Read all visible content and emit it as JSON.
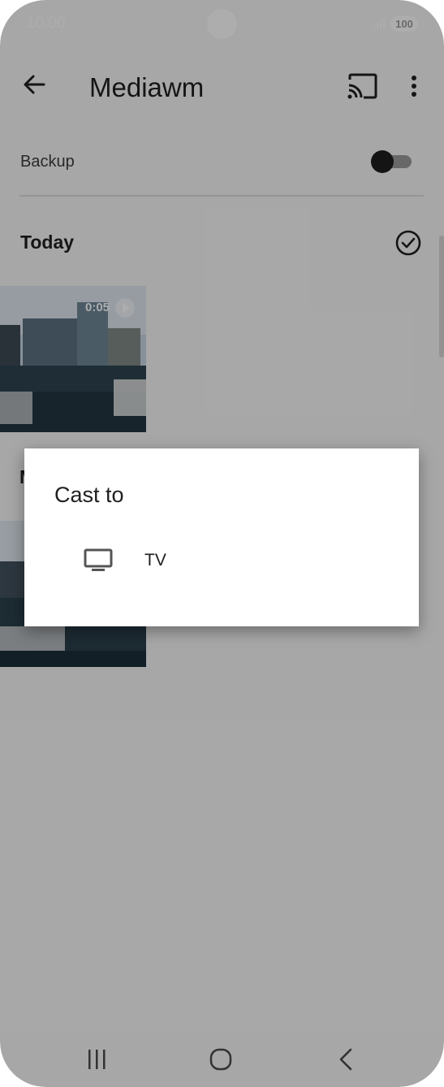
{
  "status_bar": {
    "time": "10.00",
    "battery": "100"
  },
  "app_bar": {
    "title": "Mediawm",
    "back_icon": "arrow-back-icon",
    "cast_icon": "cast-icon",
    "more_icon": "more-vert-icon"
  },
  "backup": {
    "label": "Backup",
    "enabled": false
  },
  "sections": [
    {
      "label": "Today",
      "items": [
        {
          "type": "video",
          "duration": "0:05"
        }
      ]
    },
    {
      "label": "M",
      "select_glyph": "o"
    }
  ],
  "dialog": {
    "title": "Cast to",
    "devices": [
      {
        "name": "TV",
        "icon": "tv-icon"
      }
    ]
  },
  "colors": {
    "scrim": "#000000",
    "dialog_bg": "#ffffff",
    "text_primary": "#202020"
  }
}
